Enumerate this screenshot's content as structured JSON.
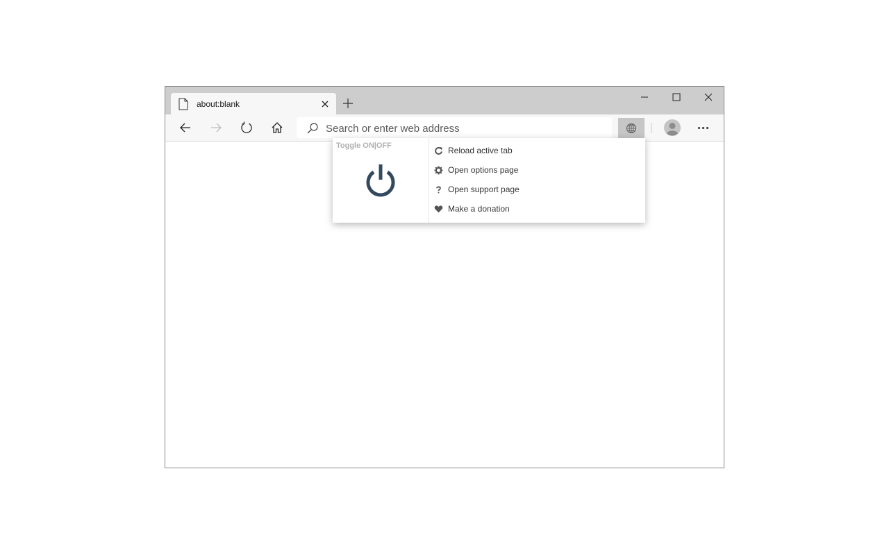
{
  "tab": {
    "title": "about:blank"
  },
  "address_bar": {
    "placeholder": "Search or enter web address"
  },
  "popup": {
    "toggle_label": "Toggle ON|OFF",
    "menu": [
      {
        "label": "Reload active tab",
        "icon": "reload-icon"
      },
      {
        "label": "Open options page",
        "icon": "gear-icon"
      },
      {
        "label": "Open support page",
        "icon": "question-icon"
      },
      {
        "label": "Make a donation",
        "icon": "heart-icon"
      }
    ]
  },
  "colors": {
    "tabstrip": "#cdcdcd",
    "toolbar": "#f7f7f7",
    "power_icon": "#34495e",
    "extension_active": "#c6c6c6"
  }
}
